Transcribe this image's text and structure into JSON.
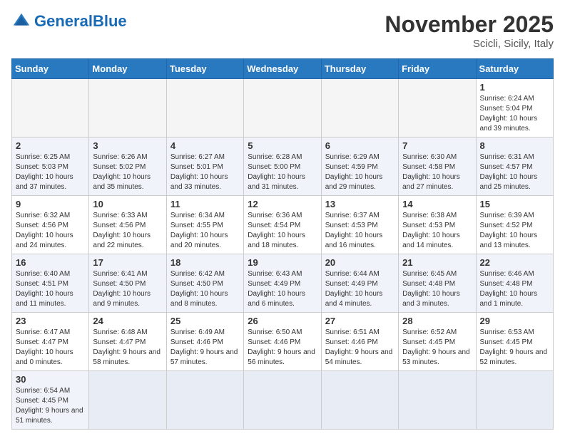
{
  "header": {
    "logo_general": "General",
    "logo_blue": "Blue",
    "month_title": "November 2025",
    "location": "Scicli, Sicily, Italy"
  },
  "weekdays": [
    "Sunday",
    "Monday",
    "Tuesday",
    "Wednesday",
    "Thursday",
    "Friday",
    "Saturday"
  ],
  "weeks": [
    [
      {
        "day": "",
        "info": ""
      },
      {
        "day": "",
        "info": ""
      },
      {
        "day": "",
        "info": ""
      },
      {
        "day": "",
        "info": ""
      },
      {
        "day": "",
        "info": ""
      },
      {
        "day": "",
        "info": ""
      },
      {
        "day": "1",
        "info": "Sunrise: 6:24 AM\nSunset: 5:04 PM\nDaylight: 10 hours and 39 minutes."
      }
    ],
    [
      {
        "day": "2",
        "info": "Sunrise: 6:25 AM\nSunset: 5:03 PM\nDaylight: 10 hours and 37 minutes."
      },
      {
        "day": "3",
        "info": "Sunrise: 6:26 AM\nSunset: 5:02 PM\nDaylight: 10 hours and 35 minutes."
      },
      {
        "day": "4",
        "info": "Sunrise: 6:27 AM\nSunset: 5:01 PM\nDaylight: 10 hours and 33 minutes."
      },
      {
        "day": "5",
        "info": "Sunrise: 6:28 AM\nSunset: 5:00 PM\nDaylight: 10 hours and 31 minutes."
      },
      {
        "day": "6",
        "info": "Sunrise: 6:29 AM\nSunset: 4:59 PM\nDaylight: 10 hours and 29 minutes."
      },
      {
        "day": "7",
        "info": "Sunrise: 6:30 AM\nSunset: 4:58 PM\nDaylight: 10 hours and 27 minutes."
      },
      {
        "day": "8",
        "info": "Sunrise: 6:31 AM\nSunset: 4:57 PM\nDaylight: 10 hours and 25 minutes."
      }
    ],
    [
      {
        "day": "9",
        "info": "Sunrise: 6:32 AM\nSunset: 4:56 PM\nDaylight: 10 hours and 24 minutes."
      },
      {
        "day": "10",
        "info": "Sunrise: 6:33 AM\nSunset: 4:56 PM\nDaylight: 10 hours and 22 minutes."
      },
      {
        "day": "11",
        "info": "Sunrise: 6:34 AM\nSunset: 4:55 PM\nDaylight: 10 hours and 20 minutes."
      },
      {
        "day": "12",
        "info": "Sunrise: 6:36 AM\nSunset: 4:54 PM\nDaylight: 10 hours and 18 minutes."
      },
      {
        "day": "13",
        "info": "Sunrise: 6:37 AM\nSunset: 4:53 PM\nDaylight: 10 hours and 16 minutes."
      },
      {
        "day": "14",
        "info": "Sunrise: 6:38 AM\nSunset: 4:53 PM\nDaylight: 10 hours and 14 minutes."
      },
      {
        "day": "15",
        "info": "Sunrise: 6:39 AM\nSunset: 4:52 PM\nDaylight: 10 hours and 13 minutes."
      }
    ],
    [
      {
        "day": "16",
        "info": "Sunrise: 6:40 AM\nSunset: 4:51 PM\nDaylight: 10 hours and 11 minutes."
      },
      {
        "day": "17",
        "info": "Sunrise: 6:41 AM\nSunset: 4:50 PM\nDaylight: 10 hours and 9 minutes."
      },
      {
        "day": "18",
        "info": "Sunrise: 6:42 AM\nSunset: 4:50 PM\nDaylight: 10 hours and 8 minutes."
      },
      {
        "day": "19",
        "info": "Sunrise: 6:43 AM\nSunset: 4:49 PM\nDaylight: 10 hours and 6 minutes."
      },
      {
        "day": "20",
        "info": "Sunrise: 6:44 AM\nSunset: 4:49 PM\nDaylight: 10 hours and 4 minutes."
      },
      {
        "day": "21",
        "info": "Sunrise: 6:45 AM\nSunset: 4:48 PM\nDaylight: 10 hours and 3 minutes."
      },
      {
        "day": "22",
        "info": "Sunrise: 6:46 AM\nSunset: 4:48 PM\nDaylight: 10 hours and 1 minute."
      }
    ],
    [
      {
        "day": "23",
        "info": "Sunrise: 6:47 AM\nSunset: 4:47 PM\nDaylight: 10 hours and 0 minutes."
      },
      {
        "day": "24",
        "info": "Sunrise: 6:48 AM\nSunset: 4:47 PM\nDaylight: 9 hours and 58 minutes."
      },
      {
        "day": "25",
        "info": "Sunrise: 6:49 AM\nSunset: 4:46 PM\nDaylight: 9 hours and 57 minutes."
      },
      {
        "day": "26",
        "info": "Sunrise: 6:50 AM\nSunset: 4:46 PM\nDaylight: 9 hours and 56 minutes."
      },
      {
        "day": "27",
        "info": "Sunrise: 6:51 AM\nSunset: 4:46 PM\nDaylight: 9 hours and 54 minutes."
      },
      {
        "day": "28",
        "info": "Sunrise: 6:52 AM\nSunset: 4:45 PM\nDaylight: 9 hours and 53 minutes."
      },
      {
        "day": "29",
        "info": "Sunrise: 6:53 AM\nSunset: 4:45 PM\nDaylight: 9 hours and 52 minutes."
      }
    ],
    [
      {
        "day": "30",
        "info": "Sunrise: 6:54 AM\nSunset: 4:45 PM\nDaylight: 9 hours and 51 minutes."
      },
      {
        "day": "",
        "info": ""
      },
      {
        "day": "",
        "info": ""
      },
      {
        "day": "",
        "info": ""
      },
      {
        "day": "",
        "info": ""
      },
      {
        "day": "",
        "info": ""
      },
      {
        "day": "",
        "info": ""
      }
    ]
  ]
}
